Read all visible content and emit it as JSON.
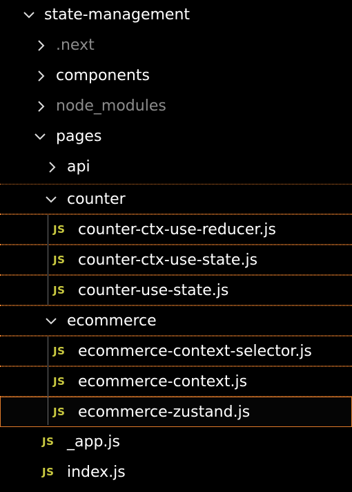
{
  "explorer": {
    "root": {
      "label": "state-management",
      "expanded": true,
      "icon": "chevron-down-icon"
    },
    "items": [
      {
        "label": ".next",
        "type": "folder",
        "expanded": false,
        "dimmed": true
      },
      {
        "label": "components",
        "type": "folder",
        "expanded": false,
        "dimmed": false
      },
      {
        "label": "node_modules",
        "type": "folder",
        "expanded": false,
        "dimmed": true
      },
      {
        "label": "pages",
        "type": "folder",
        "expanded": true,
        "dimmed": false
      },
      {
        "label": "api",
        "type": "folder",
        "expanded": false,
        "dimmed": false
      },
      {
        "label": "counter",
        "type": "folder",
        "expanded": true,
        "dimmed": false
      },
      {
        "label": "counter-ctx-use-reducer.js",
        "type": "file",
        "icon_text": "JS"
      },
      {
        "label": "counter-ctx-use-state.js",
        "type": "file",
        "icon_text": "JS"
      },
      {
        "label": "counter-use-state.js",
        "type": "file",
        "icon_text": "JS"
      },
      {
        "label": "ecommerce",
        "type": "folder",
        "expanded": true,
        "dimmed": false
      },
      {
        "label": "ecommerce-context-selector.js",
        "type": "file",
        "icon_text": "JS"
      },
      {
        "label": "ecommerce-context.js",
        "type": "file",
        "icon_text": "JS"
      },
      {
        "label": "ecommerce-zustand.js",
        "type": "file",
        "icon_text": "JS",
        "selected": true
      },
      {
        "label": "_app.js",
        "type": "file",
        "icon_text": "JS"
      },
      {
        "label": "index.js",
        "type": "file",
        "icon_text": "JS"
      }
    ]
  },
  "colors": {
    "background": "#000000",
    "text": "#ffffff",
    "dimmed_text": "#8c8c8c",
    "js_icon": "#cbcb41",
    "highlight_border": "#e07a2a",
    "guide_line": "#6e6e6e"
  }
}
